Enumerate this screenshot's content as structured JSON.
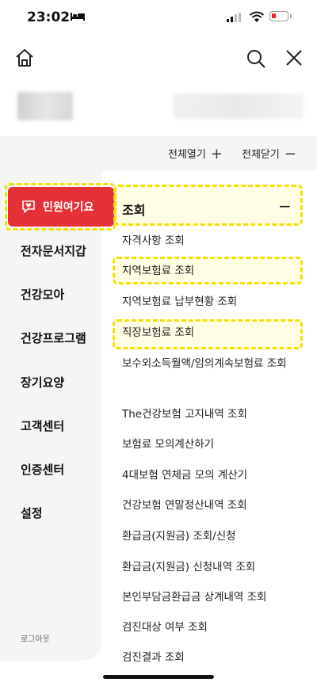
{
  "status_bar": {
    "time": "23:02"
  },
  "controls": {
    "expand_all": "전체열기",
    "collapse_all": "전체닫기",
    "expand_symbol": "+",
    "collapse_symbol": "−"
  },
  "complaint_button": {
    "label": "민원여기요"
  },
  "sidebar": {
    "items": [
      {
        "label": "전자문서지갑"
      },
      {
        "label": "건강모아"
      },
      {
        "label": "건강프로그램"
      },
      {
        "label": "장기요양"
      },
      {
        "label": "고객센터"
      },
      {
        "label": "인증센터"
      },
      {
        "label": "설정"
      }
    ],
    "logout": "로그아웃"
  },
  "section": {
    "title": "조회",
    "toggle": "−",
    "items": [
      {
        "label": "자격사항 조회"
      },
      {
        "label": "지역보험료 조회"
      },
      {
        "label": "지역보험료 납부현황 조회"
      },
      {
        "label": "직장보험료 조회"
      },
      {
        "label": "보수외소득월액/임의계속보험료 조회"
      },
      {
        "label": "The건강보험 고지내역 조회"
      },
      {
        "label": "보험료 모의계산하기"
      },
      {
        "label": "4대보험 연체금 모의 계산기"
      },
      {
        "label": "건강보험 연말정산내역 조회"
      },
      {
        "label": "환급금(지원금) 조회/신청"
      },
      {
        "label": "환급금(지원금) 신청내역 조회"
      },
      {
        "label": "본인부담금환급금 상계내역 조회"
      },
      {
        "label": "검진대상 여부 조회"
      },
      {
        "label": "검진결과 조회"
      }
    ]
  },
  "colors": {
    "accent_red": "#e43137",
    "highlight_yellow": "#f2e205",
    "sidebar_bg": "#f5f5f5"
  }
}
